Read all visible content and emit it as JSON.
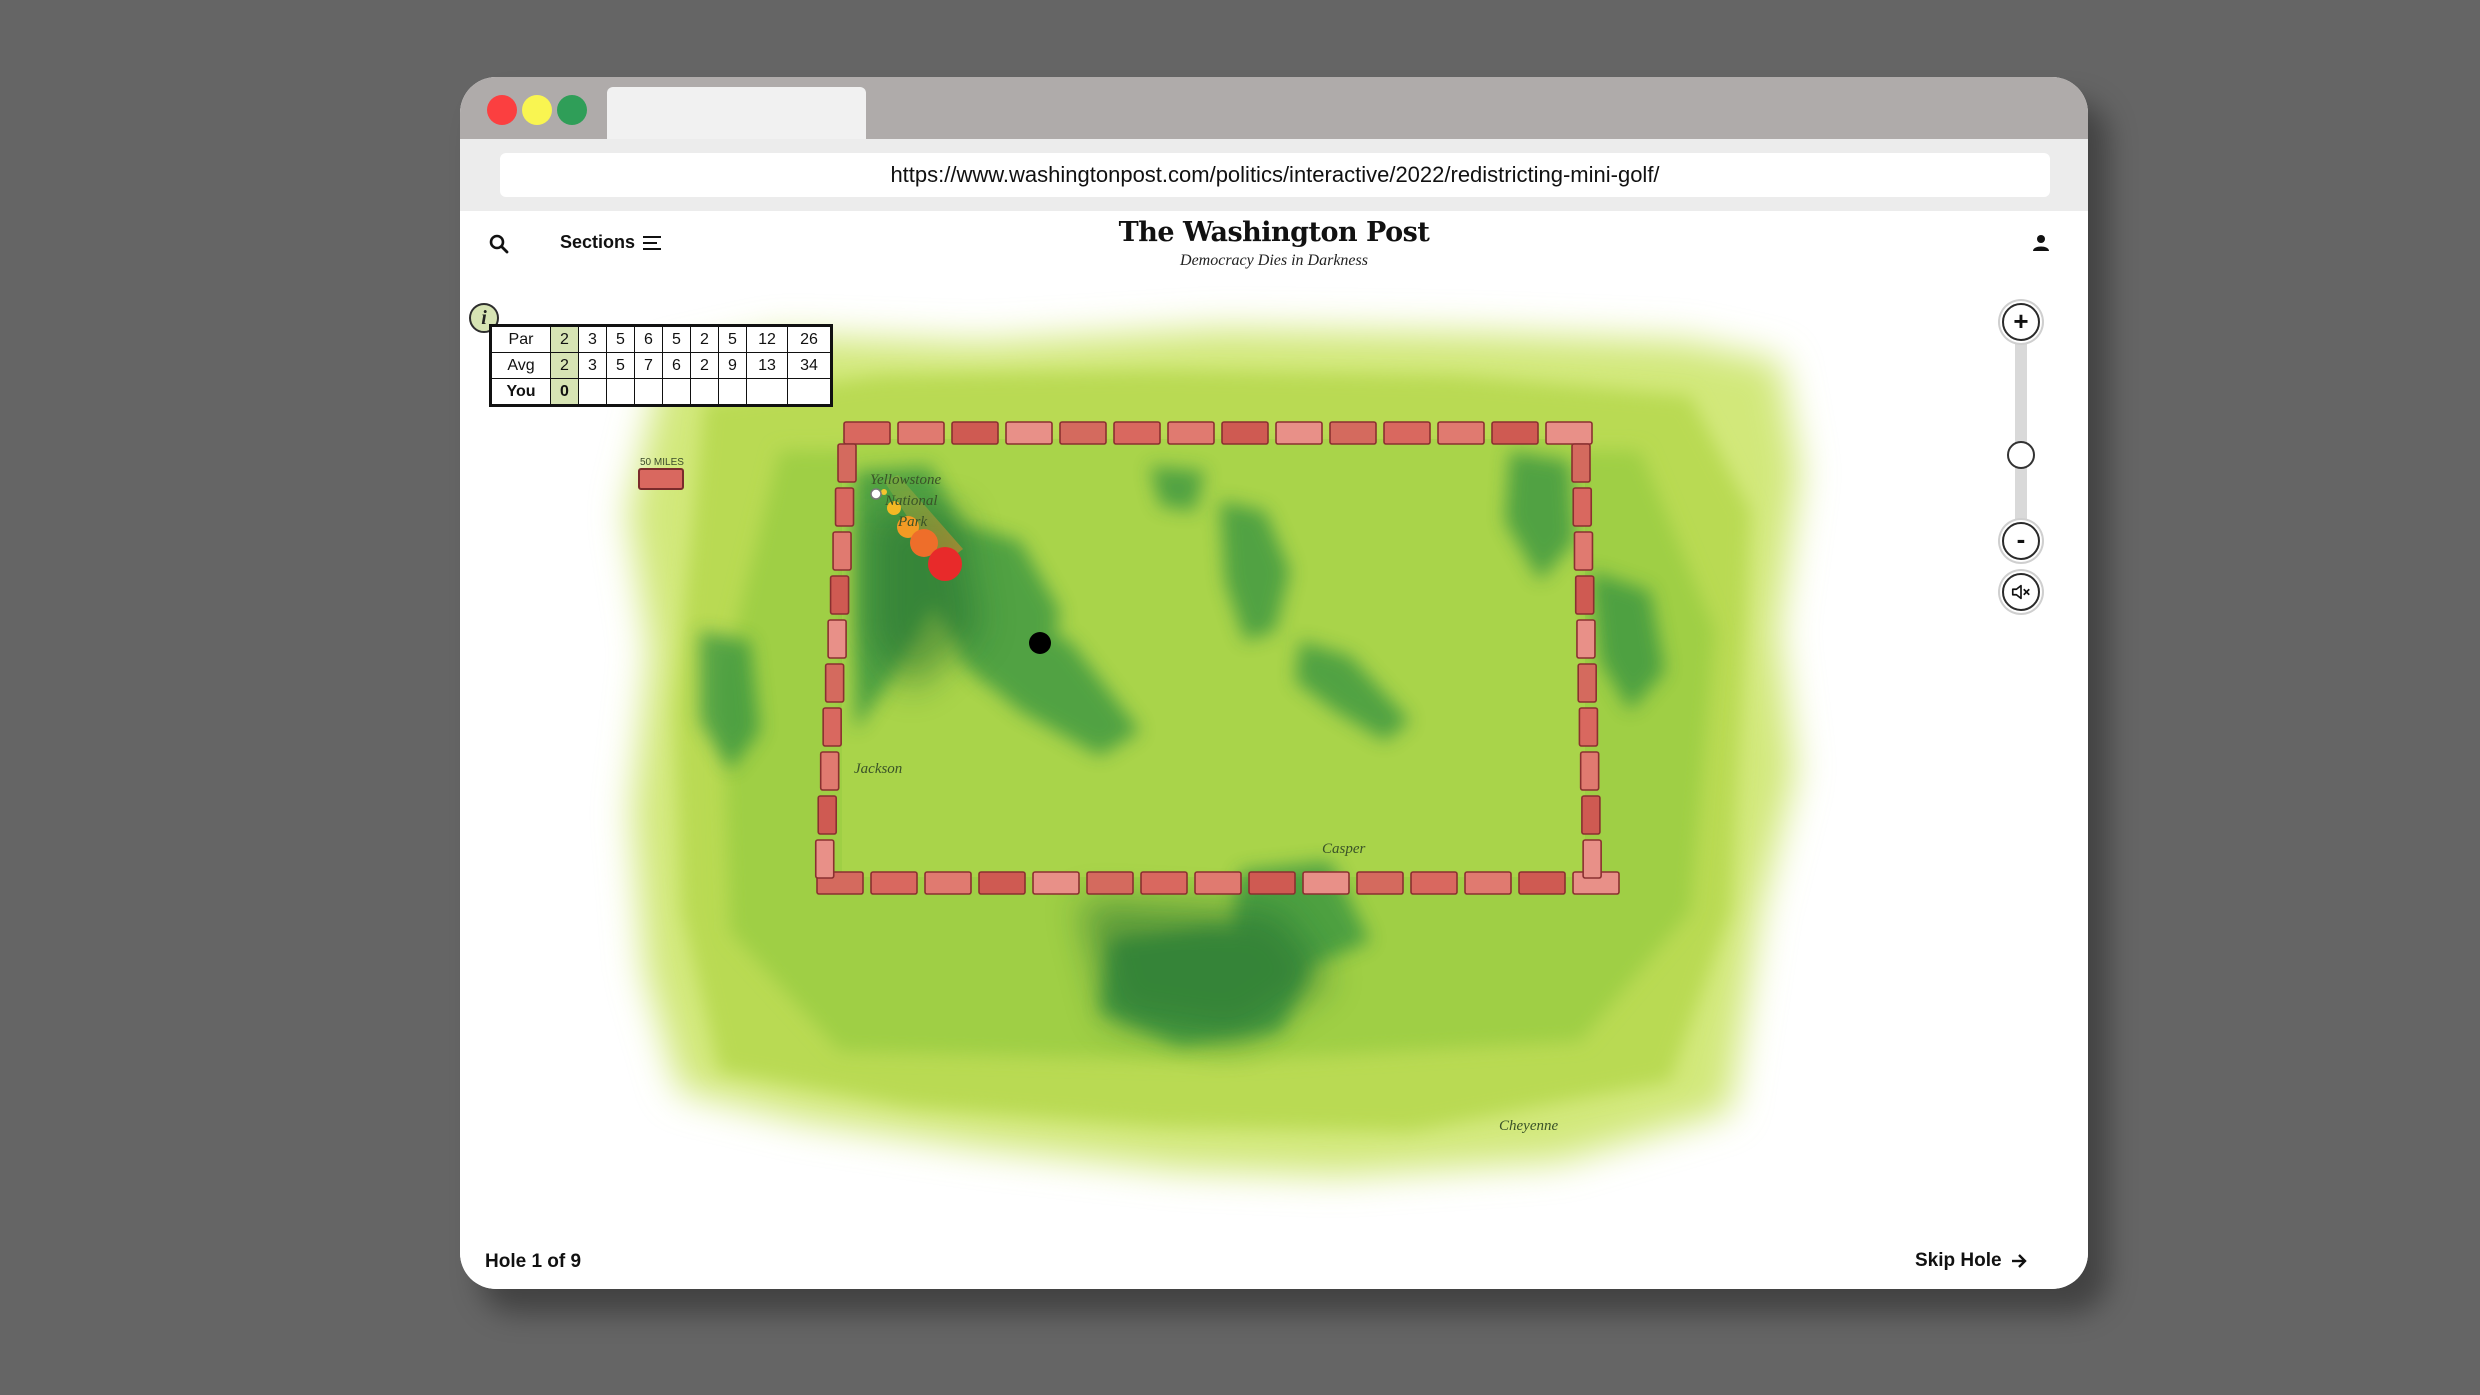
{
  "browser": {
    "url": "https://www.washingtonpost.com/politics/interactive/2022/redistricting-mini-golf/"
  },
  "header": {
    "sections_label": "Sections",
    "logo": "The Washington Post",
    "tagline": "Democracy Dies in Darkness",
    "icons": [
      "search-icon",
      "menu-icon",
      "user-icon"
    ]
  },
  "scorecard": {
    "info_label": "i",
    "rows": [
      {
        "label": "Par",
        "values": [
          "2",
          "3",
          "5",
          "6",
          "5",
          "2",
          "5",
          "12",
          "26"
        ]
      },
      {
        "label": "Avg",
        "values": [
          "2",
          "3",
          "5",
          "7",
          "6",
          "2",
          "9",
          "13",
          "34"
        ]
      },
      {
        "label": "You",
        "values": [
          "0",
          "",
          "",
          "",
          "",
          "",
          "",
          "",
          ""
        ]
      }
    ]
  },
  "map": {
    "labels": {
      "park": [
        "Yellowstone",
        "National",
        "Park"
      ],
      "scale": "50 MILES",
      "jackson": "Jackson",
      "casper": "Casper",
      "cheyenne": "Cheyenne"
    }
  },
  "zoom": {
    "zoom_in": "+",
    "zoom_out": "-",
    "mute_icon": "speaker-muted-icon"
  },
  "footer": {
    "hole_label": "Hole 1 of 9",
    "skip_label": "Skip Hole"
  },
  "colors": {
    "background": "#656565",
    "tabbar": "#afabaa",
    "highlight_cell": "#d7e4b4",
    "grass_light": "#b5d84a",
    "grass_dark": "#2f8f3f",
    "brick": "#d9685f",
    "ball": "#ffffff",
    "hole": "#000000"
  }
}
